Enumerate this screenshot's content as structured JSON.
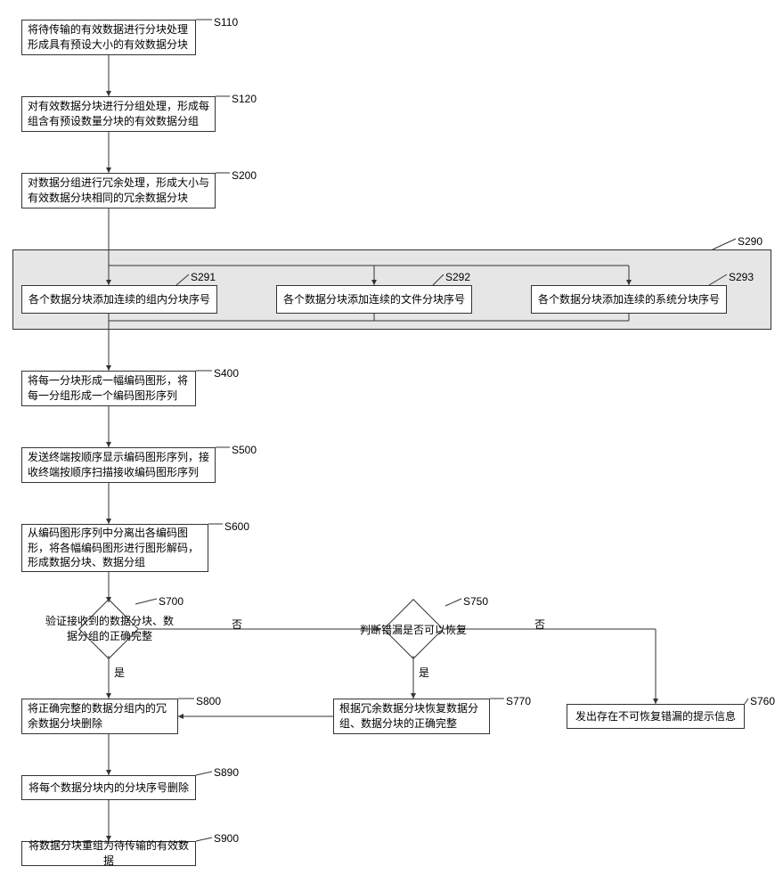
{
  "step_labels": {
    "s110": "S110",
    "s120": "S120",
    "s200": "S200",
    "s290": "S290",
    "s291": "S291",
    "s292": "S292",
    "s293": "S293",
    "s400": "S400",
    "s500": "S500",
    "s600": "S600",
    "s700": "S700",
    "s750": "S750",
    "s760": "S760",
    "s770": "S770",
    "s800": "S800",
    "s890": "S890",
    "s900": "S900"
  },
  "boxes": {
    "s110": "将待传输的有效数据进行分块处理形成具有预设大小的有效数据分块",
    "s120": "对有效数据分块进行分组处理，形成每组含有预设数量分块的有效数据分组",
    "s200": "对数据分组进行冗余处理，形成大小与有效数据分块相同的冗余数据分块",
    "s291": "各个数据分块添加连续的组内分块序号",
    "s292": "各个数据分块添加连续的文件分块序号",
    "s293": "各个数据分块添加连续的系统分块序号",
    "s400": "将每一分块形成一幅编码图形，将每一分组形成一个编码图形序列",
    "s500": "发送终端按顺序显示编码图形序列，接收终端按顺序扫描接收编码图形序列",
    "s600": "从编码图形序列中分离出各编码图形，将各幅编码图形进行图形解码，形成数据分块、数据分组",
    "s700": "验证接收到的数据分块、数据分组的正确完整",
    "s750": "判断错漏是否可以恢复",
    "s760": "发出存在不可恢复错漏的提示信息",
    "s770": "根据冗余数据分块恢复数据分组、数据分块的正确完整",
    "s800": "将正确完整的数据分组内的冗余数据分块删除",
    "s890": "将每个数据分块内的分块序号删除",
    "s900": "将数据分块重组为待传输的有效数据"
  },
  "branches": {
    "yes": "是",
    "no": "否"
  }
}
